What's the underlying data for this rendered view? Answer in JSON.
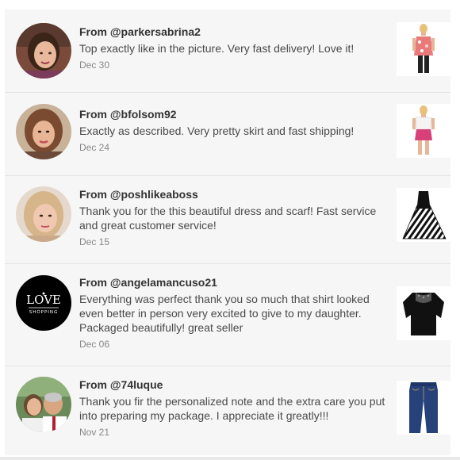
{
  "reviews": [
    {
      "from": "From @parkersabrina2",
      "text": "Top exactly like in the picture. Very fast delivery! Love it!",
      "date": "Dec 30",
      "item_icon": "floral-top-model-icon"
    },
    {
      "from": "From @bfolsom92",
      "text": "Exactly as described. Very pretty skirt and fast shipping!",
      "date": "Dec 24",
      "item_icon": "pink-skirt-model-icon"
    },
    {
      "from": "From @poshlikeaboss",
      "text": "Thank you for the this beautiful dress and scarf! Fast service and great customer service!",
      "date": "Dec 15",
      "item_icon": "striped-dress-icon"
    },
    {
      "from": "From @angelamancuso21",
      "text": "Everything was perfect thank you so much that shirt looked even better in person very excited to give to my daughter. Packaged beautifully! great seller",
      "date": "Dec 06",
      "item_icon": "black-lace-shirt-icon"
    },
    {
      "from": "From @74luque",
      "text": "Thank you fir the personalized note and the extra care you put into preparing my package. I appreciate it greatly!!!",
      "date": "Nov 21",
      "item_icon": "jeans-icon"
    }
  ],
  "avatar_logo": {
    "line1": "LOVE",
    "line2": "SHOPPING"
  },
  "colors": {
    "card_bg": "#f6f6f6",
    "text": "#4a4a4a",
    "username": "#333333",
    "date": "#888888"
  }
}
